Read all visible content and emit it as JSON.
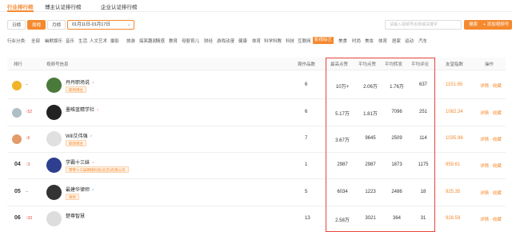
{
  "top_tabs": [
    "行业排行榜",
    "博主认证排行榜",
    "企业认证排行榜"
  ],
  "filters": {
    "periods": [
      {
        "label": "日榜",
        "active": false
      },
      {
        "label": "周榜",
        "active": true
      },
      {
        "label": "月榜",
        "active": false
      }
    ],
    "date_range": "01月11日-01月17日",
    "search_placeholder": "请输入视频号名称或关键字",
    "search_label": "搜索",
    "add_label": "+ 添加视频号"
  },
  "categories": {
    "label": "行业分类:",
    "items": [
      "全部",
      "幽默娱乐",
      "音乐",
      "生活",
      "人文艺术",
      "摄影",
      "旅游",
      "搞笑趣闻",
      "情感",
      "教育",
      "母婴育儿",
      "财经",
      "游戏动漫",
      "健康",
      "体育",
      "科学科教",
      "科技",
      "互联网",
      "影视综艺",
      "美食",
      "时尚",
      "美妆",
      "体育",
      "居家",
      "运动",
      "汽车"
    ],
    "active_index": 18
  },
  "table": {
    "headers": [
      "排行",
      "视频号信息",
      "周作品数",
      "最高点赞",
      "平均点赞",
      "平均转发",
      "平均评论",
      "友望指数",
      "操作"
    ],
    "rows": [
      {
        "rank": "",
        "change": "--",
        "change_type": "flat",
        "badge": "gold",
        "name": "丹丹职场说",
        "gender": "♀",
        "tag": "职场博主",
        "works": "6",
        "max_likes": "10万+",
        "avg_likes": "2.06万",
        "avg_shares": "1.76万",
        "avg_comments": "637",
        "index": "1151.65",
        "ops": "详情 · 收藏"
      },
      {
        "rank": "",
        "change": "↑52",
        "change_type": "up",
        "badge": "silver",
        "name": "墨唯蓝精学社",
        "gender": "♀",
        "tag": "",
        "works": "6",
        "max_likes": "5.17万",
        "avg_likes": "1.81万",
        "avg_shares": "7096",
        "avg_comments": "251",
        "index": "1082.34",
        "ops": "详情 · 收藏"
      },
      {
        "rank": "",
        "change": "↑6",
        "change_type": "up",
        "badge": "bronze",
        "name": "Will艾伟强",
        "gender": "♂",
        "tag": "职场博主",
        "works": "7",
        "max_likes": "3.67万",
        "avg_likes": "9645",
        "avg_shares": "2509",
        "avg_comments": "114",
        "index": "1035.96",
        "ops": "详情 · 收藏"
      },
      {
        "rank": "04",
        "change": "↑3",
        "change_type": "up",
        "badge": "",
        "name": "学霸十三妹",
        "gender": "♀",
        "tag": "零零十三妹网络科技(北京)有限公司",
        "works": "1",
        "max_likes": "2987",
        "avg_likes": "2987",
        "avg_shares": "1873",
        "avg_comments": "1175",
        "index": "959.61",
        "ops": "详情 · 收藏"
      },
      {
        "rank": "05",
        "change": "--",
        "change_type": "flat",
        "badge": "",
        "name": "最建华律师",
        "gender": "♂",
        "tag": "律师",
        "works": "5",
        "max_likes": "6034",
        "avg_likes": "1223",
        "avg_shares": "2486",
        "avg_comments": "18",
        "index": "925.35",
        "ops": "详情 · 收藏"
      },
      {
        "rank": "06",
        "change": "↑33",
        "change_type": "up",
        "badge": "",
        "name": "楚尊智慧",
        "gender": "",
        "tag": "",
        "works": "13",
        "max_likes": "2.58万",
        "avg_likes": "3021",
        "avg_shares": "364",
        "avg_comments": "31",
        "index": "928.59",
        "ops": "详情 · 收藏"
      }
    ]
  },
  "colors": {
    "accent": "#f5892e",
    "highlight_box": "#e8453c",
    "up": "#e8453c"
  }
}
